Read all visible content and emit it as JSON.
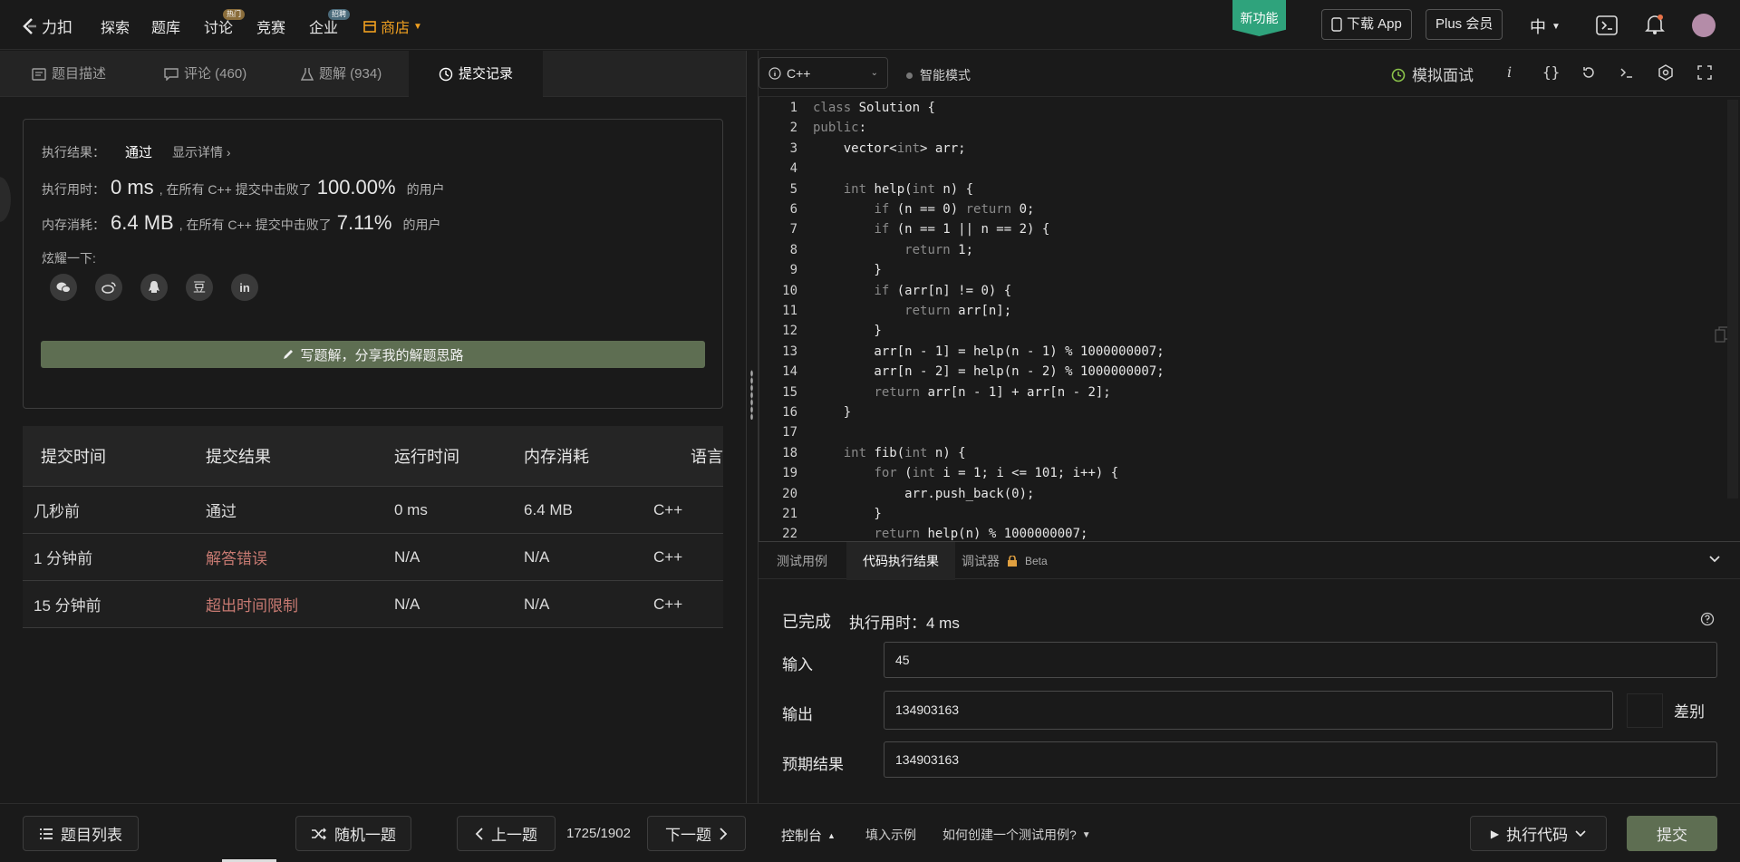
{
  "nav": {
    "logo": "力扣",
    "items": [
      "探索",
      "题库",
      "讨论",
      "竞赛",
      "企业"
    ],
    "discuss_badge": "热门",
    "enterprise_badge": "招聘",
    "store": "商店",
    "new_feature": "新功能",
    "download_app": "下载 App",
    "plus": "Plus 会员",
    "lang": "中"
  },
  "left_tabs": {
    "description": "题目描述",
    "comments": "评论 (460)",
    "solutions": "题解 (934)",
    "submissions": "提交记录"
  },
  "result": {
    "exec_result_label": "执行结果：",
    "exec_result_value": "通过",
    "show_details": "显示详情 ›",
    "time_label": "执行用时：",
    "time_value": "0 ms",
    "time_mid": ", 在所有 C++ 提交中击败了",
    "time_percent": "100.00%",
    "time_suffix": "的用户",
    "mem_label": "内存消耗：",
    "mem_value": "6.4 MB",
    "mem_mid": ", 在所有 C++ 提交中击败了",
    "mem_percent": "7.11%",
    "mem_suffix": "的用户",
    "share_label": "炫耀一下:",
    "share_icons": [
      "wechat-icon",
      "weibo-icon",
      "qq-icon",
      "douban-icon",
      "linkedin-icon"
    ],
    "douban_glyph": "豆",
    "linkedin_glyph": "in",
    "write_solution": "写题解，分享我的解题思路"
  },
  "submissions": {
    "headers": [
      "提交时间",
      "提交结果",
      "运行时间",
      "内存消耗",
      "语言"
    ],
    "rows": [
      {
        "time": "几秒前",
        "result": "通过",
        "runtime": "0 ms",
        "memory": "6.4 MB",
        "lang": "C++"
      },
      {
        "time": "1 分钟前",
        "result": "解答错误",
        "runtime": "N/A",
        "memory": "N/A",
        "lang": "C++"
      },
      {
        "time": "15 分钟前",
        "result": "超出时间限制",
        "runtime": "N/A",
        "memory": "N/A",
        "lang": "C++"
      }
    ]
  },
  "editor_toolbar": {
    "language": "C++",
    "smart_mode": "智能模式",
    "mock_interview": "模拟面试"
  },
  "code": [
    {
      "n": "1",
      "text": "class Solution {"
    },
    {
      "n": "2",
      "text": "public:"
    },
    {
      "n": "3",
      "text": "    vector<int> arr;"
    },
    {
      "n": "4",
      "text": ""
    },
    {
      "n": "5",
      "text": "    int help(int n) {"
    },
    {
      "n": "6",
      "text": "        if (n == 0) return 0;"
    },
    {
      "n": "7",
      "text": "        if (n == 1 || n == 2) {"
    },
    {
      "n": "8",
      "text": "            return 1;"
    },
    {
      "n": "9",
      "text": "        }"
    },
    {
      "n": "10",
      "text": "        if (arr[n] != 0) {"
    },
    {
      "n": "11",
      "text": "            return arr[n];"
    },
    {
      "n": "12",
      "text": "        }"
    },
    {
      "n": "13",
      "text": "        arr[n - 1] = help(n - 1) % 1000000007;"
    },
    {
      "n": "14",
      "text": "        arr[n - 2] = help(n - 2) % 1000000007;"
    },
    {
      "n": "15",
      "text": "        return arr[n - 1] + arr[n - 2];"
    },
    {
      "n": "16",
      "text": "    }"
    },
    {
      "n": "17",
      "text": ""
    },
    {
      "n": "18",
      "text": "    int fib(int n) {"
    },
    {
      "n": "19",
      "text": "        for (int i = 1; i <= 101; i++) {"
    },
    {
      "n": "20",
      "text": "            arr.push_back(0);"
    },
    {
      "n": "21",
      "text": "        }"
    },
    {
      "n": "22",
      "text": "        return help(n) % 1000000007;"
    }
  ],
  "console": {
    "tabs": [
      "测试用例",
      "代码执行结果",
      "调试器"
    ],
    "beta": "Beta",
    "status": "已完成",
    "exec_time": "执行用时：4 ms",
    "input_label": "输入",
    "input_value": "45",
    "output_label": "输出",
    "output_value": "134903163",
    "diff": "差别",
    "expected_label": "预期结果",
    "expected_value": "134903163"
  },
  "bottom": {
    "problem_list": "题目列表",
    "random": "随机一题",
    "prev": "上一题",
    "page": "1725/1902",
    "next": "下一题",
    "console": "控制台",
    "fill_example": "填入示例",
    "how_to": "如何创建一个测试用例?",
    "run": "执行代码",
    "submit": "提交"
  },
  "colors": {
    "accent_green": "#5e6e52",
    "new_feature": "#2fa37c",
    "error": "#c87a72",
    "store": "#f0a020"
  }
}
